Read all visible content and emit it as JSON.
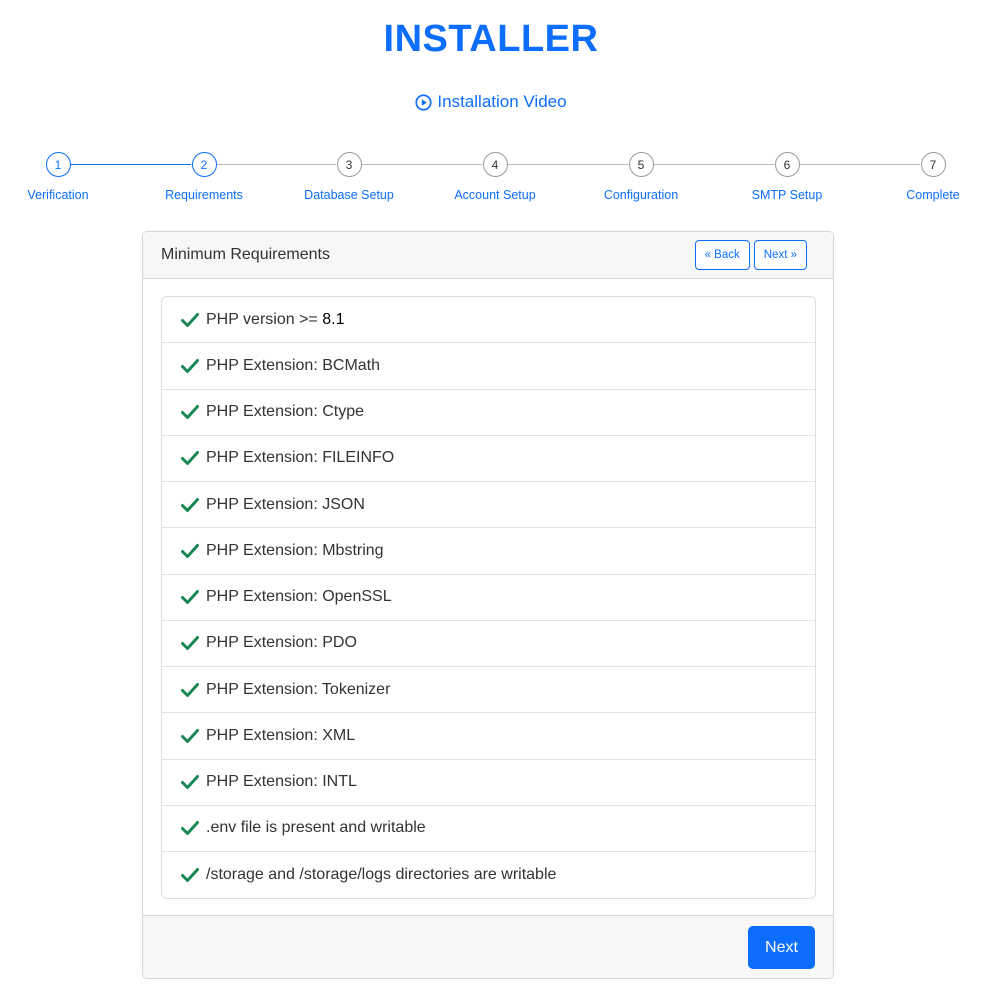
{
  "header": {
    "title": "INSTALLER",
    "video_link": "Installation Video"
  },
  "stepper": {
    "active_count": 2,
    "steps": [
      {
        "number": "1",
        "label": "Verification"
      },
      {
        "number": "2",
        "label": "Requirements"
      },
      {
        "number": "3",
        "label": "Database Setup"
      },
      {
        "number": "4",
        "label": "Account Setup"
      },
      {
        "number": "5",
        "label": "Configuration"
      },
      {
        "number": "6",
        "label": "SMTP Setup"
      },
      {
        "number": "7",
        "label": "Complete"
      }
    ]
  },
  "card": {
    "title": "Minimum Requirements",
    "back_label": "« Back",
    "next_small_label": "Next »",
    "requirements": [
      {
        "text": "PHP version >= ",
        "version": "8.1",
        "status": "pass"
      },
      {
        "text": "PHP Extension: BCMath",
        "status": "pass"
      },
      {
        "text": "PHP Extension: Ctype",
        "status": "pass"
      },
      {
        "text": "PHP Extension: FILEINFO",
        "status": "pass"
      },
      {
        "text": "PHP Extension: JSON",
        "status": "pass"
      },
      {
        "text": "PHP Extension: Mbstring",
        "status": "pass"
      },
      {
        "text": "PHP Extension: OpenSSL",
        "status": "pass"
      },
      {
        "text": "PHP Extension: PDO",
        "status": "pass"
      },
      {
        "text": "PHP Extension: Tokenizer",
        "status": "pass"
      },
      {
        "text": "PHP Extension: XML",
        "status": "pass"
      },
      {
        "text": "PHP Extension: INTL",
        "status": "pass"
      },
      {
        "text": ".env file is present and writable",
        "status": "pass"
      },
      {
        "text": "/storage and /storage/logs directories are writable",
        "status": "pass"
      }
    ],
    "next_label": "Next"
  },
  "colors": {
    "primary": "#0d6efd",
    "success": "#198754",
    "inactive_line": "#bbbbbb"
  }
}
